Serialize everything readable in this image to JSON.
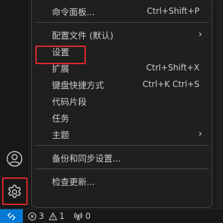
{
  "menu": {
    "items": [
      {
        "label": "命令面板...",
        "shortcut": "Ctrl+Shift+P",
        "submenu": false
      },
      {
        "label": "配置文件 (默认)",
        "shortcut": "",
        "submenu": true
      },
      {
        "label": "设置",
        "shortcut": "",
        "submenu": false
      },
      {
        "label": "扩展",
        "shortcut": "Ctrl+Shift+X",
        "submenu": false
      },
      {
        "label": "键盘快捷方式",
        "shortcut": "Ctrl+K Ctrl+S",
        "submenu": false
      },
      {
        "label": "代码片段",
        "shortcut": "",
        "submenu": false
      },
      {
        "label": "任务",
        "shortcut": "",
        "submenu": false
      },
      {
        "label": "主题",
        "shortcut": "",
        "submenu": true
      },
      {
        "label": "备份和同步设置...",
        "shortcut": "",
        "submenu": false
      },
      {
        "label": "检查更新...",
        "shortcut": "",
        "submenu": false
      }
    ],
    "chevron": "›"
  },
  "activity_bar": {
    "icons": [
      "account-icon",
      "manage-gear-icon"
    ]
  },
  "status_bar": {
    "remote_icon": "remote-icon",
    "errors": "3",
    "warnings": "1",
    "ports": "0"
  },
  "colors": {
    "highlight": "#e0282e",
    "remote_bg": "#0078d4",
    "background": "#1f1f1f"
  }
}
